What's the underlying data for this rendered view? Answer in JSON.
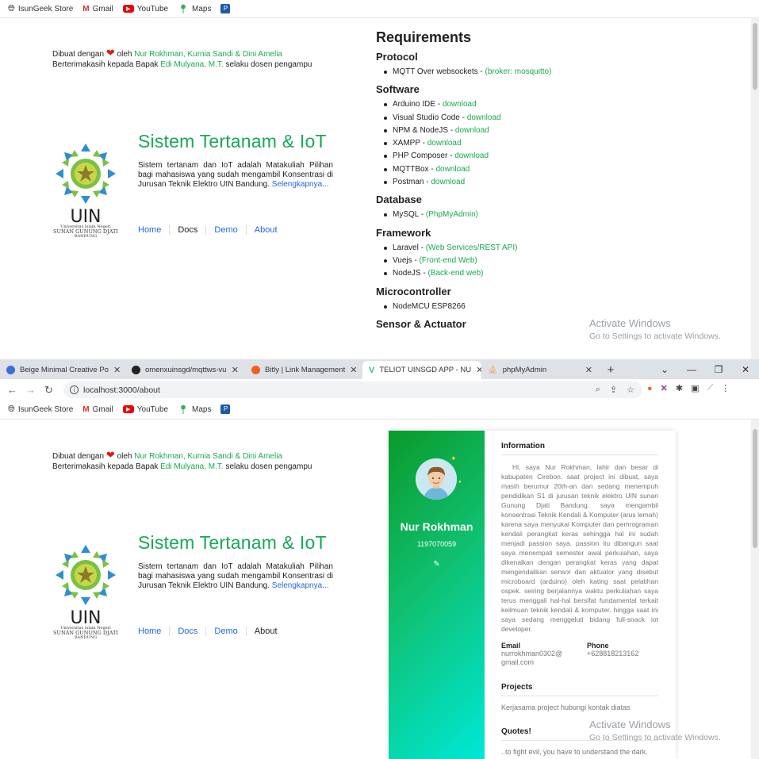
{
  "bookmarks": [
    {
      "label": "IsunGeek Store",
      "icon": "globe-icon"
    },
    {
      "label": "Gmail",
      "icon": "gmail-icon"
    },
    {
      "label": "YouTube",
      "icon": "youtube-icon"
    },
    {
      "label": "Maps",
      "icon": "maps-icon"
    },
    {
      "label": "",
      "icon": "p-app-icon"
    }
  ],
  "credits": {
    "line1_prefix": "Dibuat dengan",
    "line1_by": "oleh",
    "authors": "Nur Rokhman, Kurnia Sandi & Dini Amelia",
    "line2_prefix": "Berterimakasih kepada Bapak",
    "advisor": "Edi Mulyana, M.T.",
    "line2_suffix": "selaku dosen pengampu"
  },
  "hero": {
    "title": "Sistem Tertanam & IoT",
    "description": "Sistem tertanam dan IoT adalah Matakuliah Pilihan bagi mahasiswa yang sudah mengambil Konsentrasi di Jurusan Teknik Elektro UIN Bandung.",
    "more_link": "Selengkapnya...",
    "logo_text": "UIN",
    "logo_university_line1": "Universitas Islam Negeri",
    "logo_university_line2": "SUNAN GUNUNG DJATI",
    "logo_university_line3": "BANDUNG"
  },
  "nav_top": [
    "Home",
    "Docs",
    "Demo",
    "About"
  ],
  "nav_bottom": [
    "Home",
    "Docs",
    "Demo",
    "About"
  ],
  "requirements": {
    "title": "Requirements",
    "sections": [
      {
        "heading": "Protocol",
        "items": [
          {
            "text": "MQTT Over websockets - ",
            "link": "(broker: mosquitto)"
          }
        ]
      },
      {
        "heading": "Software",
        "items": [
          {
            "text": "Arduino IDE - ",
            "link": "download"
          },
          {
            "text": "Visual Studio Code - ",
            "link": "download"
          },
          {
            "text": "NPM & NodeJS - ",
            "link": "download"
          },
          {
            "text": "XAMPP - ",
            "link": "download"
          },
          {
            "text": "PHP Composer - ",
            "link": "download"
          },
          {
            "text": "MQTTBox - ",
            "link": "download"
          },
          {
            "text": "Postman - ",
            "link": "download"
          }
        ]
      },
      {
        "heading": "Database",
        "items": [
          {
            "text": "MySQL - ",
            "link": "(PhpMyAdmin)"
          }
        ]
      },
      {
        "heading": "Framework",
        "items": [
          {
            "text": "Laravel - ",
            "link": "(Web Services/REST API)"
          },
          {
            "text": "Vuejs - ",
            "link": "(Front-end Web)"
          },
          {
            "text": "NodeJS - ",
            "link": "(Back-end web)"
          }
        ]
      },
      {
        "heading": "Microcontroller",
        "items": [
          {
            "text": "NodeMCU ESP8266",
            "link": ""
          }
        ]
      },
      {
        "heading": "Sensor & Actuator",
        "items": []
      }
    ]
  },
  "watermark": {
    "title": "Activate Windows",
    "subtitle": "Go to Settings to activate Windows."
  },
  "tabs": [
    {
      "label": "Beige Minimal Creative Po",
      "color": "#3b6fd8",
      "active": false
    },
    {
      "label": "omenxuinsgd/mqttws-vu",
      "color": "#222222",
      "active": false
    },
    {
      "label": "Bitly | Link Management",
      "color": "#ee6123",
      "active": false
    },
    {
      "label": "TELIOT UINSGD APP - NU",
      "color": "#41b883",
      "active": true
    },
    {
      "label": "phpMyAdmin",
      "color": "#f0a030",
      "active": false
    }
  ],
  "window_controls": {
    "dropdown": "⌄",
    "minimize": "—",
    "restore": "❐",
    "close": "✕"
  },
  "address": {
    "url": "localhost:3000/about"
  },
  "profile": {
    "name": "Nur Rokhman",
    "id": "1197070059",
    "info_heading": "Information",
    "info_text": "Hi, saya Nur Rokhman, lahir dan besar di kabupaten Cirebon. saat project ini dibuat, saya masih berumur 20th-an dan sedang menempuh pendidikan S1 di jurusan teknik elektro UIN sunan Gunung Djati Bandung. saya mengambil konsentrasi Teknik Kendali & Komputer (arus lemah) karena saya menyukai Komputer dan pemrograman kendali perangkat keras sehingga hal ini sudah menjadi passion saya. passion itu dibangun saat saya menempati semester awal perkuiahan, saya dikenalkan dengan perangkat keras yang dapat mengendalikan sensor dan aktuator yang disebut microboard (arduino) oleh kating saat pelatihan ospek. seiring berjalannya waktu perkuliahan saya terus menggali hal-hal bersifat fundamental terkait keilmuan teknik kendali & komputer. hingga saat ini saya sedang menggeluti bidang full-snack iot developer.",
    "email_label": "Email",
    "email_value": "nurrokhman0302@ gmail.com",
    "phone_label": "Phone",
    "phone_value": "+628818213162",
    "projects_heading": "Projects",
    "projects_text": "Kerjasama project hubungi kontak diatas",
    "quotes_heading": "Quotes!",
    "quotes_text": "..to fight evil, you have to understand the dark."
  }
}
